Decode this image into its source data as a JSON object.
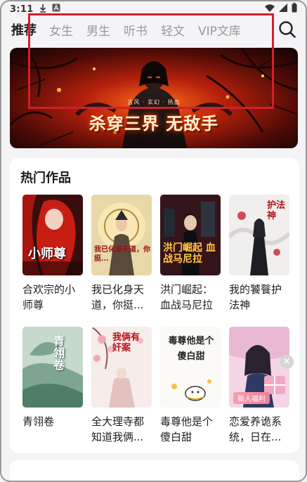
{
  "status_bar": {
    "time": "3:11"
  },
  "nav": {
    "tabs": [
      {
        "label": "推荐",
        "active": true
      },
      {
        "label": "女生",
        "active": false
      },
      {
        "label": "男生",
        "active": false
      },
      {
        "label": "听书",
        "active": false
      },
      {
        "label": "轻文",
        "active": false
      },
      {
        "label": "VIP文库",
        "active": false
      }
    ],
    "search_icon": "search-icon"
  },
  "banner": {
    "title": "杀穿三界 无敌手",
    "subtitle": "古风 · 玄幻 · 热血"
  },
  "hot": {
    "heading": "热门作品",
    "books": [
      {
        "name": "合欢宗的小师尊",
        "cover_text": "小师尊"
      },
      {
        "name": "我已化身天道，你挺...",
        "cover_text": "我已化身天道，你挺...",
        "display_name": "我已化身天道，你挺..."
      },
      {
        "name": "洪门崛起：血战马尼拉",
        "cover_text": "洪门崛起 血战马尼拉"
      },
      {
        "name": "我的饕餮护法神",
        "cover_text": "护法神"
      },
      {
        "name": "青翎卷",
        "cover_text": "青翎卷"
      },
      {
        "name": "全大理寺都知道我俩...",
        "cover_text": "我俩有奸案",
        "display_name": "全大理寺都知道我俩..."
      },
      {
        "name": "毒尊他是个傻白甜",
        "cover_text": "毒尊他是个 傻白甜"
      },
      {
        "name": "恋爱养诡系统，日在...",
        "cover_text": "",
        "badge": "新人福利"
      }
    ]
  },
  "colors": {
    "accent": "#d0202a",
    "badge": "#f37b96"
  }
}
